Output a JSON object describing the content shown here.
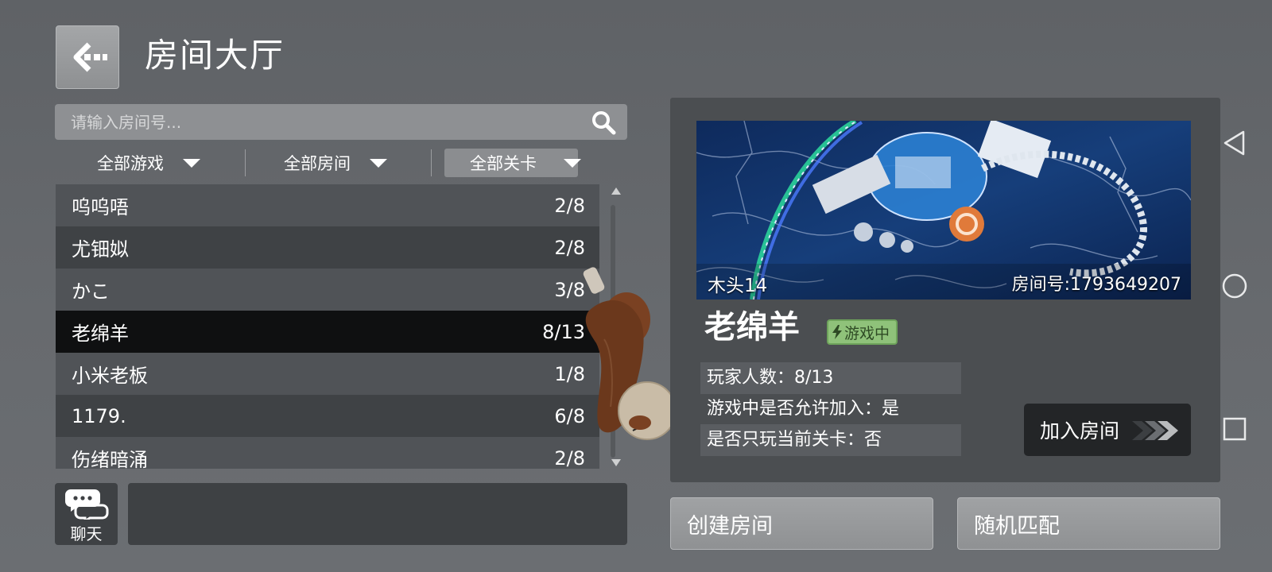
{
  "header": {
    "title": "房间大厅"
  },
  "search": {
    "placeholder": "请输入房间号..."
  },
  "filters": [
    {
      "label": "全部游戏"
    },
    {
      "label": "全部房间"
    },
    {
      "label": "全部关卡"
    }
  ],
  "rooms": [
    {
      "name": "呜呜唔",
      "players": "2/8"
    },
    {
      "name": "尤钿姒",
      "players": "2/8"
    },
    {
      "name": "かこ",
      "players": "3/8"
    },
    {
      "name": "老绵羊",
      "players": "8/13"
    },
    {
      "name": "小米老板",
      "players": "1/8"
    },
    {
      "name": "1179.",
      "players": "6/8"
    },
    {
      "name": "伤绪暗涌",
      "players": "2/8"
    }
  ],
  "selected_room_index": 3,
  "chat": {
    "label": "聊天"
  },
  "detail": {
    "owner": "木头14",
    "room_id": "房间号:1793649207",
    "name": "老绵羊",
    "status": "游戏中",
    "player_count": "玩家人数：8/13",
    "allow_join": "游戏中是否允许加入：是",
    "current_level_only": "是否只玩当前关卡：否",
    "join_label": "加入房间"
  },
  "actions": {
    "create_label": "创建房间",
    "random_label": "随机匹配"
  },
  "colors": {
    "status_green": "#8fc27a",
    "selected_row": "#0f1011",
    "panel": "#4b4e51"
  }
}
